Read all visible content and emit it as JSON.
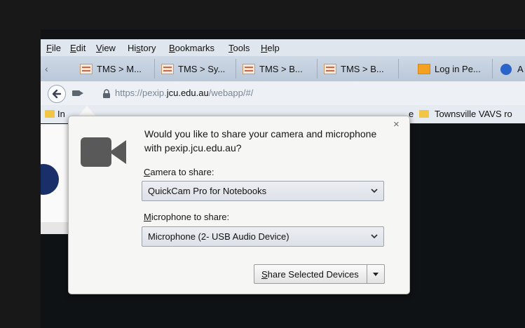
{
  "menu": {
    "file": {
      "u": "F",
      "rest": "ile"
    },
    "edit": {
      "u": "E",
      "rest": "dit"
    },
    "view": {
      "u": "V",
      "rest": "iew"
    },
    "history": {
      "pre": "Hi",
      "u": "s",
      "rest": "tory"
    },
    "bookmarks": {
      "u": "B",
      "rest": "ookmarks"
    },
    "tools": {
      "u": "T",
      "rest": "ools"
    },
    "help": {
      "u": "H",
      "rest": "elp"
    }
  },
  "tabs": [
    {
      "label": "TMS > M..."
    },
    {
      "label": "TMS > Sy..."
    },
    {
      "label": "TMS > B..."
    },
    {
      "label": "TMS > B..."
    },
    {
      "label": "Log in Pe..."
    },
    {
      "label": "A"
    }
  ],
  "nav": {
    "url_pre": "https://pexip.",
    "url_domain": "jcu.edu.au",
    "url_post": "/webapp/#/"
  },
  "bookmarks": {
    "left": "In",
    "mid_fragment": "e",
    "right": "Townsville VAVS ro"
  },
  "popup": {
    "message": "Would you like to share your camera and microphone with pexip.jcu.edu.au?",
    "camera_label": {
      "u": "C",
      "rest": "amera to share:"
    },
    "camera_value": "QuickCam Pro for Notebooks",
    "mic_label": {
      "u": "M",
      "rest": "icrophone to share:"
    },
    "mic_value": "Microphone (2- USB Audio Device)",
    "share_button": {
      "u": "S",
      "rest": "hare Selected Devices"
    },
    "close_glyph": "×"
  }
}
